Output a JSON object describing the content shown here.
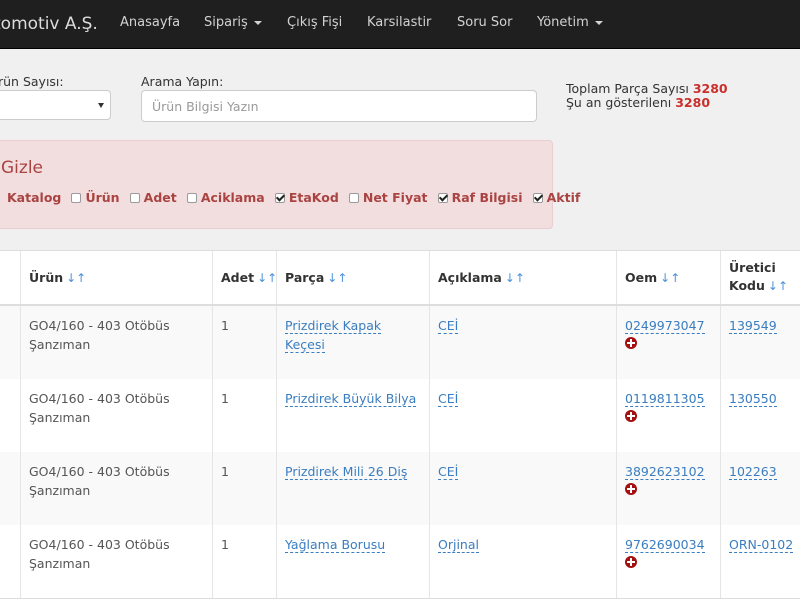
{
  "navbar": {
    "brand": "tomotiv A.Ş.",
    "items": [
      "Anasayfa",
      "Sipariş",
      "Çıkış Fişi",
      "Karsilastir",
      "Soru Sor",
      "Yönetim"
    ]
  },
  "filters": {
    "count_label": "rün Sayısı:",
    "search_label": "Arama Yapın:",
    "search_placeholder": "Ürün Bilgisi Yazın"
  },
  "totals": {
    "total_label": "Toplam Parça Sayısı",
    "total_value": "3280",
    "shown_label": "Şu an gösterilenı",
    "shown_value": "3280"
  },
  "hide_panel": {
    "title": "Gizle",
    "options": [
      {
        "label": "Katalog",
        "checked": false
      },
      {
        "label": "Ürün",
        "checked": false
      },
      {
        "label": "Adet",
        "checked": false
      },
      {
        "label": "Aciklama",
        "checked": true
      },
      {
        "label": "EtaKod",
        "checked": false
      },
      {
        "label": "Net Fiyat",
        "checked": true
      },
      {
        "label": "Raf Bilgisi",
        "checked": true
      },
      {
        "label": "Aktif",
        "checked": false
      }
    ]
  },
  "table": {
    "headers": {
      "urun": "Ürün",
      "adet": "Adet",
      "parca": "Parça",
      "aciklama": "Açıklama",
      "oem": "Oem",
      "uretici_1": "Üretici",
      "uretici_2": "Kodu"
    },
    "rows": [
      {
        "urun_1": "GO4/160 - 403 Otöbüs",
        "urun_2": "Şanzıman",
        "adet": "1",
        "parca_1": "Prizdirek Kapak",
        "parca_2": "Keçesi",
        "aciklama": "CEİ",
        "oem": "0249973047",
        "uretici": "139549"
      },
      {
        "urun_1": "GO4/160 - 403 Otöbüs",
        "urun_2": "Şanzıman",
        "adet": "1",
        "parca_1": "Prizdirek Büyük Bilya",
        "parca_2": "",
        "aciklama": "CEİ",
        "oem": "0119811305",
        "uretici": "130550"
      },
      {
        "urun_1": "GO4/160 - 403 Otöbüs",
        "urun_2": "Şanzıman",
        "adet": "1",
        "parca_1": "Prizdirek Mili 26 Diş",
        "parca_2": "",
        "aciklama": "CEİ",
        "oem": "3892623102",
        "uretici": "102263"
      },
      {
        "urun_1": "GO4/160 - 403 Otöbüs",
        "urun_2": "Şanzıman",
        "adet": "1",
        "parca_1": "Yağlama Borusu",
        "parca_2": "",
        "aciklama": "Orjinal",
        "oem": "9762690034",
        "uretici": "ORN-0102"
      }
    ]
  }
}
